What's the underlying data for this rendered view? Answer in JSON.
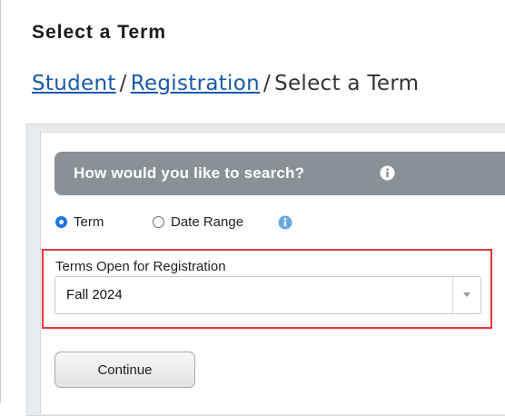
{
  "page": {
    "title": "Select a Term"
  },
  "breadcrumb": {
    "items": [
      "Student",
      "Registration"
    ],
    "current": "Select a Term",
    "separator": "/"
  },
  "search": {
    "header": "How would you like to search?",
    "header_icon": "info-icon",
    "options": [
      {
        "label": "Term",
        "selected": true
      },
      {
        "label": "Date Range",
        "selected": false
      }
    ],
    "date_range_icon": "info-icon",
    "terms_label": "Terms Open for Registration",
    "selected_term": "Fall 2024",
    "continue_label": "Continue"
  },
  "colors": {
    "link": "#1a5aa8",
    "header_bg": "#8a9196",
    "highlight": "#e0383a",
    "radio_selected": "#1a73e8"
  }
}
